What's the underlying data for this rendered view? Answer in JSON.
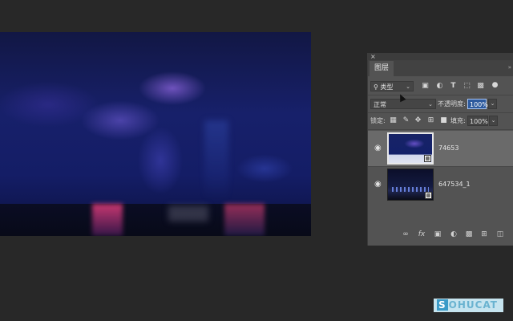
{
  "panel": {
    "close": "×",
    "collapse": "»",
    "tab_label": "图层",
    "filter": {
      "icon": "search-icon",
      "label": "类型",
      "chevron": "⌄"
    },
    "filter_icons": [
      "image-filter-icon",
      "adjustment-filter-icon",
      "text-filter-icon",
      "shape-filter-icon",
      "smart-object-filter-icon",
      "toggle-filter-icon"
    ],
    "blend_mode": "正常",
    "opacity_label": "不透明度:",
    "opacity_value": "100%",
    "lock_label": "锁定:",
    "fill_label": "填充:",
    "fill_value": "100%",
    "layers": [
      {
        "name": "74653",
        "visible": true,
        "selected": true
      },
      {
        "name": "647534_1",
        "visible": true,
        "selected": false
      }
    ],
    "footer_icons": [
      "link-icon",
      "fx-icon",
      "mask-icon",
      "adjustment-icon",
      "folder-icon",
      "new-layer-icon",
      "trash-icon"
    ]
  },
  "watermark": {
    "first": "S",
    "rest": "OHUCAT"
  }
}
